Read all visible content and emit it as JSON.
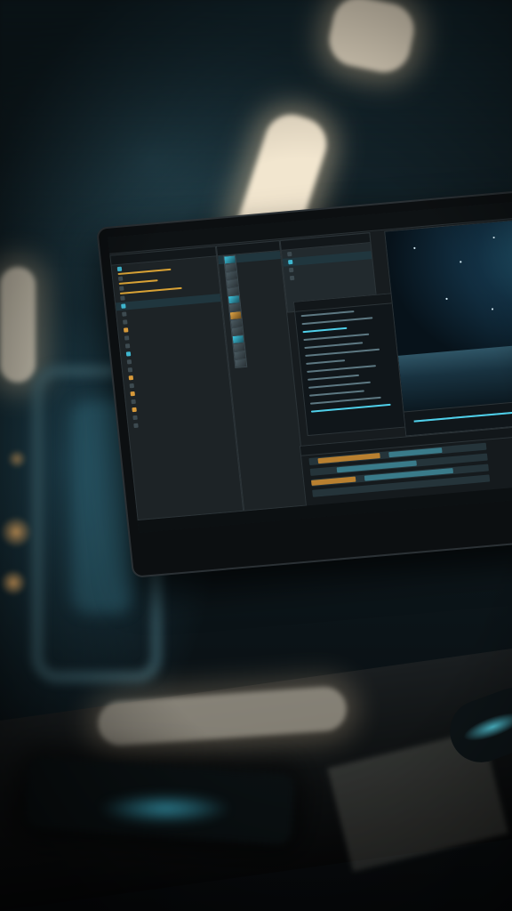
{
  "scene": {
    "subject": "monitor-editing-software",
    "accent_color": "#4fd0ea",
    "highlight_color": "#d9a235"
  },
  "editor": {
    "top_bar": {
      "app_label": "",
      "menu_label": "",
      "tab_label": "",
      "icons": [
        "play-icon",
        "crop-icon",
        "gear-icon"
      ]
    },
    "status_bar": {
      "text": ""
    }
  }
}
